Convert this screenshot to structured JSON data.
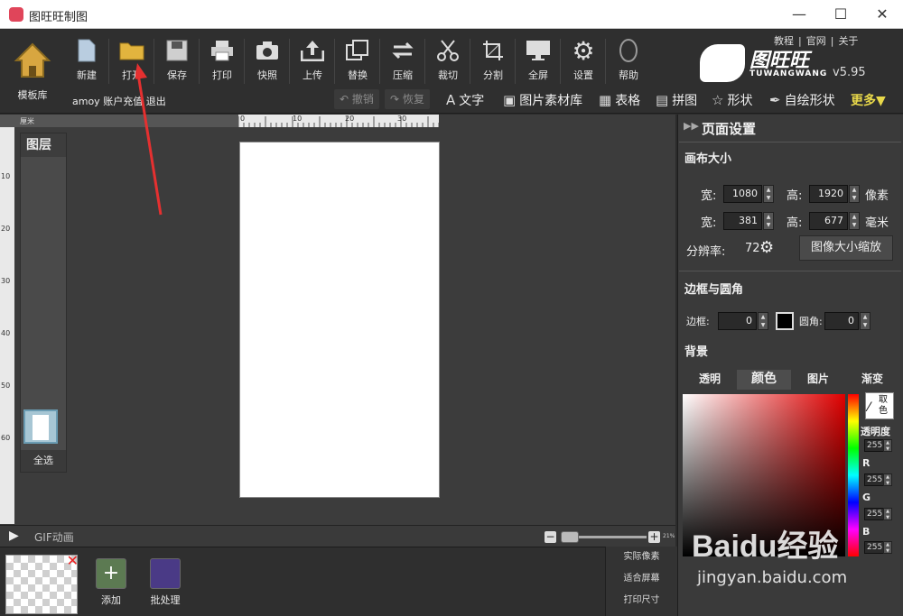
{
  "titlebar": {
    "title": "图旺旺制图",
    "min": "—",
    "max": "☐",
    "close": "✕"
  },
  "toolbar": {
    "home": "模板库",
    "tools": [
      "新建",
      "打开",
      "保存",
      "打印",
      "快照",
      "上传",
      "替换",
      "压缩",
      "裁切",
      "分割",
      "全屏",
      "设置",
      "帮助"
    ],
    "links": [
      "教程",
      "官网",
      "关于"
    ],
    "brand": "图旺旺",
    "brand_sub": "TUWANGWANG",
    "version": "v5.95",
    "account": "amoy 账户充值 退出",
    "undo": "撤销",
    "redo": "恢复",
    "sub_items": [
      "文字",
      "图片素材库",
      "表格",
      "拼图",
      "形状",
      "自绘形状"
    ],
    "more": "更多▼"
  },
  "ruler": {
    "unit": "厘米",
    "top_ticks": [
      "0",
      "10",
      "20",
      "30"
    ],
    "left_ticks": [
      "10",
      "20",
      "30",
      "40",
      "50",
      "60"
    ]
  },
  "layers": {
    "title": "图层",
    "select_all": "全选"
  },
  "gifbar": {
    "label": "GIF动画",
    "zoom_pct": "21%"
  },
  "bottom": {
    "add": "添加",
    "batch": "批处理",
    "size_options": [
      "实际像素",
      "适合屏幕",
      "打印尺寸"
    ]
  },
  "panel": {
    "title": "页面设置",
    "canvas_size": "画布大小",
    "width_label": "宽:",
    "height_label": "高:",
    "width_px": "1080",
    "height_px": "1920",
    "px_unit": "像素",
    "width_mm": "381",
    "height_mm": "677",
    "mm_unit": "毫米",
    "dpi_label": "分辨率:",
    "dpi": "72",
    "resize_btn": "图像大小缩放",
    "border_section": "边框与圆角",
    "border_label": "边框:",
    "border_val": "0",
    "corner_label": "圆角:",
    "corner_val": "0",
    "bg_section": "背景",
    "bg_tabs": [
      "透明",
      "颜色",
      "图片",
      "渐变"
    ],
    "pick_color": "取色",
    "opacity_label": "透明度",
    "opacity_val": "255",
    "r_label": "R",
    "r_val": "255",
    "g_label": "G",
    "g_val": "255",
    "b_label": "B",
    "b_val": "255"
  },
  "watermark": {
    "brand": "Baidu经验",
    "url": "jingyan.baidu.com"
  }
}
